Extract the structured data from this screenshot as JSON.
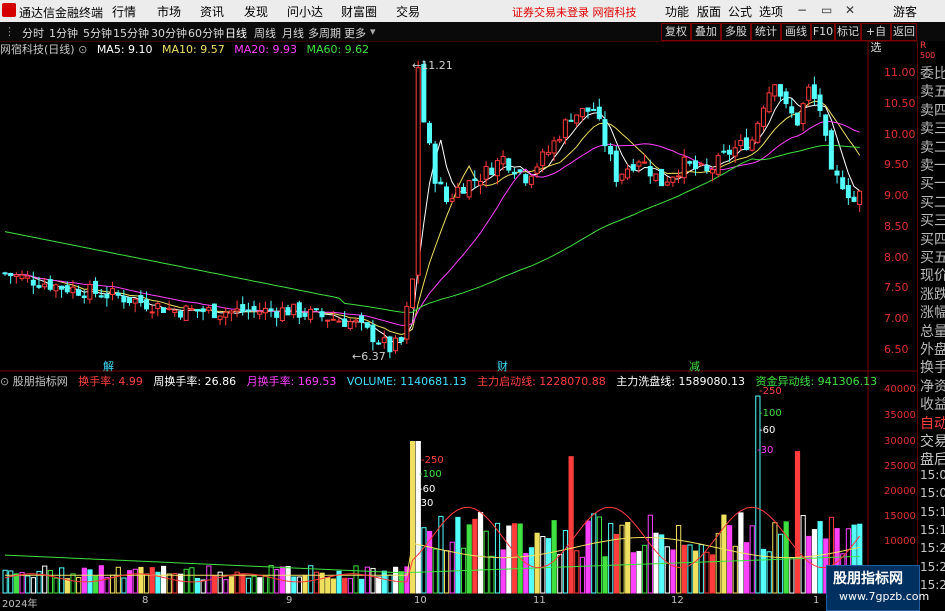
{
  "menubar": {
    "app_title": "通达信金融终端",
    "menus": [
      "行情",
      "市场",
      "资讯",
      "发现",
      "问小达",
      "财富圈",
      "交易"
    ],
    "warning": "证券交易未登录  网宿科技",
    "right_menus": [
      "功能",
      "版面",
      "公式",
      "选项"
    ],
    "guest": "游客"
  },
  "toolbar": {
    "periods": [
      "分时",
      "1分钟",
      "5分钟",
      "15分钟",
      "30分钟",
      "60分钟",
      "日线",
      "周线",
      "月线",
      "多周期",
      "更多"
    ],
    "active_period": "日线",
    "buttons": [
      "复权",
      "叠加",
      "多股",
      "统计",
      "画线",
      "F10",
      "标记",
      "+自选",
      "返回"
    ]
  },
  "price_panel": {
    "stock": "网宿科技(日线)",
    "ma": [
      {
        "label": "MA5: 9.10",
        "color": "#ffffff"
      },
      {
        "label": "MA10: 9.57",
        "color": "#f0e060"
      },
      {
        "label": "MA20: 9.93",
        "color": "#ff40ff"
      },
      {
        "label": "MA60: 9.62",
        "color": "#40e040"
      }
    ],
    "y_ticks": [
      "11.00",
      "10.50",
      "10.00",
      "9.50",
      "9.00",
      "8.50",
      "8.00",
      "7.50",
      "7.00",
      "6.50"
    ],
    "high_label": "11.21",
    "low_label": "6.37",
    "markers": [
      {
        "text": "解",
        "color": "#40e0ff"
      },
      {
        "text": "财",
        "color": "#40e0ff"
      },
      {
        "text": "减",
        "color": "#40e040"
      }
    ]
  },
  "volume_panel": {
    "title": "股朋指标网",
    "fields": [
      {
        "label": "换手率: ",
        "value": "4.99",
        "color": "#ff4040"
      },
      {
        "label": "周换手率: ",
        "value": "26.86",
        "color": "#ffffff"
      },
      {
        "label": "月换手率: ",
        "value": "169.53",
        "color": "#ff40ff"
      },
      {
        "label": "VOLUME: ",
        "value": "1140681.13",
        "color": "#40e0ff"
      },
      {
        "label": "主力启动线: ",
        "value": "1228070.88",
        "color": "#ff4040"
      },
      {
        "label": "主力洗盘线: ",
        "value": "1589080.13",
        "color": "#ffffff"
      },
      {
        "label": "资金异动线: ",
        "value": "941306.13",
        "color": "#40e040"
      }
    ],
    "y_ticks": [
      "40000",
      "35000",
      "30000",
      "25000",
      "20000",
      "15000",
      "10000"
    ],
    "ref_labels": [
      "250",
      "100",
      "60",
      "30"
    ]
  },
  "x_axis": [
    "2024年",
    "8",
    "9",
    "10",
    "11",
    "12",
    "1"
  ],
  "side_panel": [
    "R",
    "500",
    "委比",
    "卖五",
    "卖四",
    "卖三",
    "卖二",
    "卖一",
    "买一",
    "买二",
    "买三",
    "买四",
    "买五",
    "现价",
    "涨跌",
    "涨幅",
    "总量",
    "外盘",
    "换手",
    "净资",
    "收益",
    "自动",
    "交易",
    "盘后",
    "15:0",
    "15:0",
    "15:1",
    "15:1",
    "15:2",
    "15:2",
    "15:2"
  ],
  "watermark": {
    "title": "股朋指标网",
    "url": "www.7gpzb.com"
  }
}
